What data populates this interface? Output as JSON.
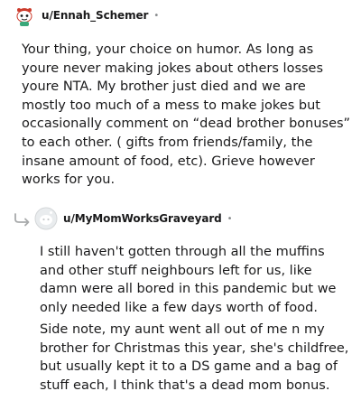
{
  "comments": [
    {
      "username": "u/Ennah_Schemer",
      "separator": "•",
      "avatar_icon": "snoo-avatar-icon",
      "paragraphs": [
        "Your thing, your choice on humor. As long as youre never making jokes about others losses youre NTA. My brother just died and we are mostly too much of a mess to make jokes but occasionally comment on “dead brother bonuses” to each other. ( gifts from friends/family, the insane amount of food, etc). Grieve however works for you."
      ]
    },
    {
      "username": "u/MyMomWorksGraveyard",
      "separator": "•",
      "avatar_icon": "default-avatar-icon",
      "reply_icon": "reply-arrow-icon",
      "paragraphs": [
        "I still haven't gotten through all the muffins and other stuff neighbours left for us, like damn were all bored in this pandemic but we only needed like a few days worth of food.",
        "Side note, my aunt went all out of me n my brother for Christmas this year, she's childfree, but usually kept it to a DS game and a bag of stuff each, I think that's a dead mom bonus."
      ]
    }
  ],
  "colors": {
    "text": "#1a1a1b",
    "meta": "#878a8c",
    "avatar_bg": "#e9ecee"
  }
}
